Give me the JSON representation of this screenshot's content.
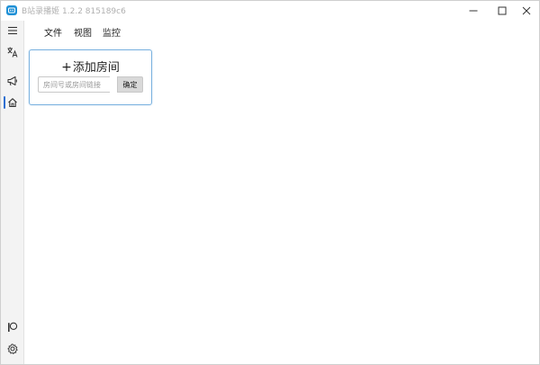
{
  "window": {
    "title": "B站录播姬 1.2.2 815189c6",
    "controls": [
      "minimize-icon",
      "maximize-icon",
      "close-icon"
    ]
  },
  "menu": {
    "items": [
      {
        "label": "文件"
      },
      {
        "label": "视图"
      },
      {
        "label": "监控"
      }
    ]
  },
  "sidebar": {
    "items": [
      {
        "icon": "hamburger-menu-icon"
      },
      {
        "icon": "translate-icon"
      },
      {
        "icon": "megaphone-icon"
      },
      {
        "icon": "home-icon",
        "active": true
      }
    ],
    "bottom_items": [
      {
        "icon": "patreon-icon"
      },
      {
        "icon": "gear-icon"
      }
    ]
  },
  "add_room_card": {
    "plus_symbol": "+",
    "title": "添加房间",
    "input_placeholder": "房间号或房间链接",
    "input_value": "",
    "confirm_label": "确定"
  },
  "colors": {
    "accent": "#2f6fd1",
    "app_icon": "#1e90d6",
    "card_border": "#7cb3e0",
    "rail_bg": "#f3f3f3"
  }
}
